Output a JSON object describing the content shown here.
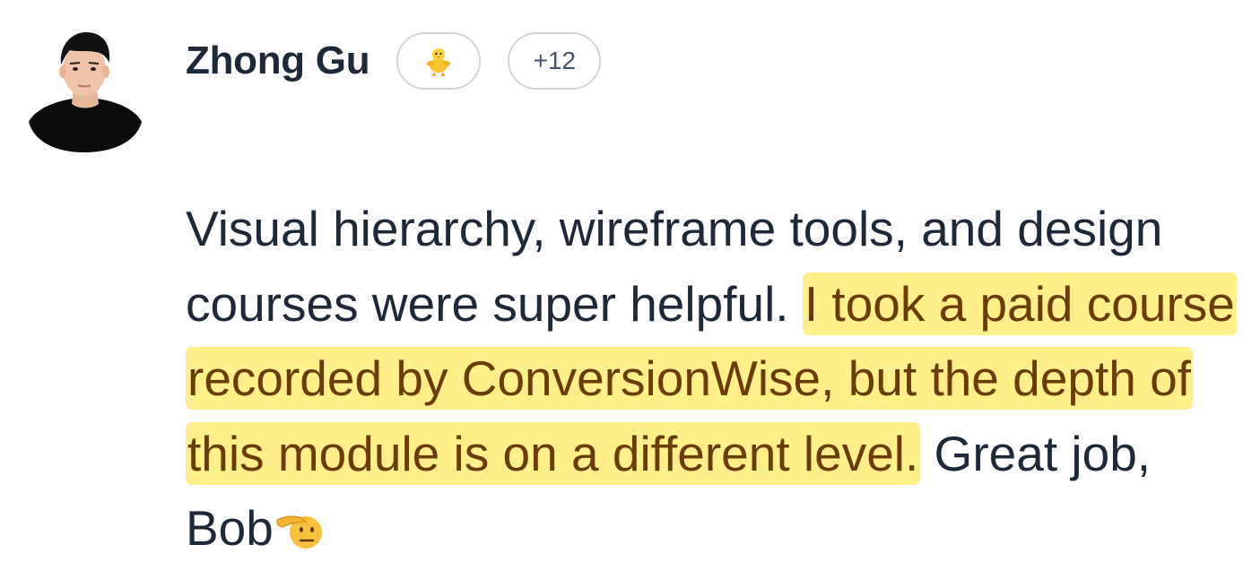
{
  "comment": {
    "author": {
      "name": "Zhong Gu",
      "avatar_icon": "person-avatar"
    },
    "reactions": {
      "primary_icon": "baby-chick-emoji",
      "more_label": "+12"
    },
    "body": {
      "text_before": "Visual hierarchy, wireframe tools, and design courses were super helpful. ",
      "highlighted": "I took a paid course recorded by ConversionWise, but the depth of this module is on a different level.",
      "text_after": " Great job, Bob",
      "trailing_icon": "saluting-face-emoji"
    },
    "colors": {
      "text": "#1d2939",
      "highlight_bg": "#fff08a",
      "highlight_text": "#6b3b0a",
      "pill_border": "#d0d5dd"
    }
  }
}
